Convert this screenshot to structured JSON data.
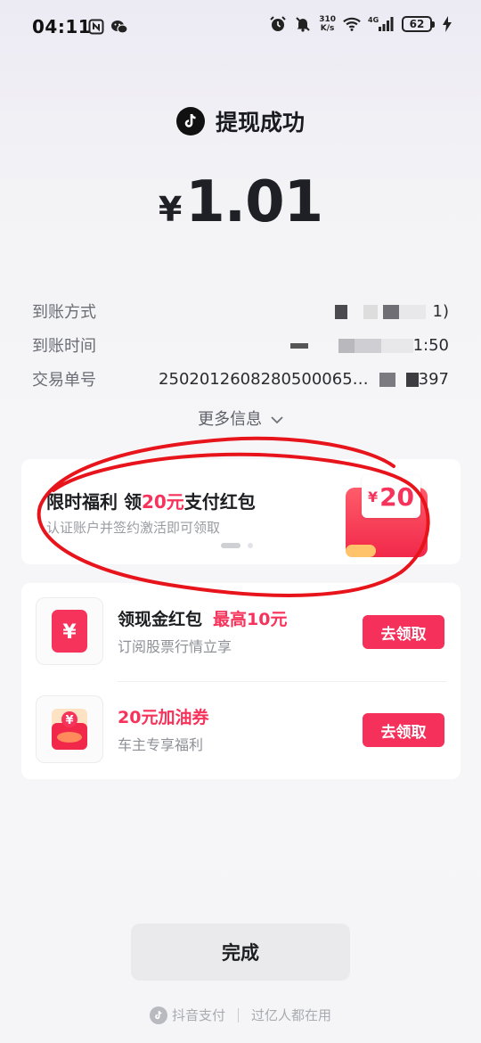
{
  "status_bar": {
    "time": "04:11",
    "net_speed_value": "310",
    "net_speed_unit": "K/s",
    "network": "4G",
    "battery": "62",
    "icons": [
      "nfc-icon",
      "wechat-icon",
      "alarm-icon",
      "mute-icon",
      "wifi-icon",
      "signal-icon",
      "charging-icon"
    ]
  },
  "header": {
    "title": "提现成功"
  },
  "amount": {
    "currency": "¥",
    "value": "1.01"
  },
  "details": [
    {
      "label": "到账方式",
      "value": "1)"
    },
    {
      "label": "到账时间",
      "value": "1:50"
    },
    {
      "label": "交易单号",
      "value_prefix": "250201260828050006",
      "value_mid": "5…",
      "value_suffix": "397"
    }
  ],
  "more_info": {
    "label": "更多信息"
  },
  "promo": {
    "title_part1": "限时福利 领",
    "title_accent": "20元",
    "title_part2": "支付红包",
    "subtitle": "认证账户并签约激活即可领取",
    "envelope_currency": "¥",
    "envelope_amount": "20",
    "carousel_pages": 2,
    "carousel_active": 0
  },
  "offers": [
    {
      "title": "领现金红包",
      "highlight": "最高10元",
      "subtitle": "订阅股票行情立享",
      "button": "去领取",
      "icon_symbol": "¥"
    },
    {
      "title": "20元加油券",
      "highlight": "",
      "subtitle": "车主专享福利",
      "button": "去领取",
      "icon_symbol": "¥"
    }
  ],
  "done_button": "完成",
  "footer": {
    "brand": "抖音支付",
    "tagline": "过亿人都在用"
  },
  "colors": {
    "accent": "#f6335b",
    "annotation": "#e8141c"
  }
}
